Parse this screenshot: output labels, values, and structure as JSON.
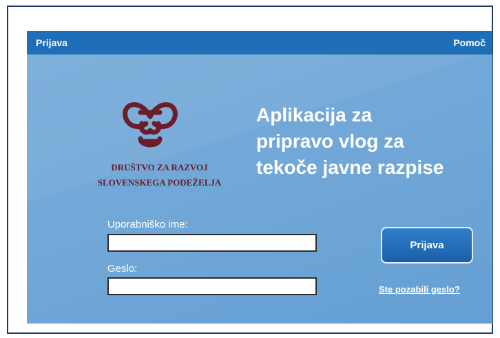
{
  "topbar": {
    "login_link": "Prijava",
    "help_link": "Pomoč"
  },
  "branding": {
    "org_line1": "DRUŠTVO ZA RAZVOJ",
    "org_line2": "SLOVENSKEGA PODEŽELJA",
    "logo_icon": "knot-heart-logo"
  },
  "hero": {
    "title_line1": "Aplikacija za",
    "title_line2": "pripravo vlog za",
    "title_line3": "tekoče javne razpise"
  },
  "form": {
    "username_label": "Uporabniško ime:",
    "username_value": "",
    "password_label": "Geslo:",
    "password_value": "",
    "submit_label": "Prijava",
    "forgot_link": "Ste pozabili geslo?"
  },
  "colors": {
    "topbar": "#1f6eb8",
    "hero": "#79acd9",
    "button": "#1b5fa8",
    "logo": "#6b1d2a"
  }
}
